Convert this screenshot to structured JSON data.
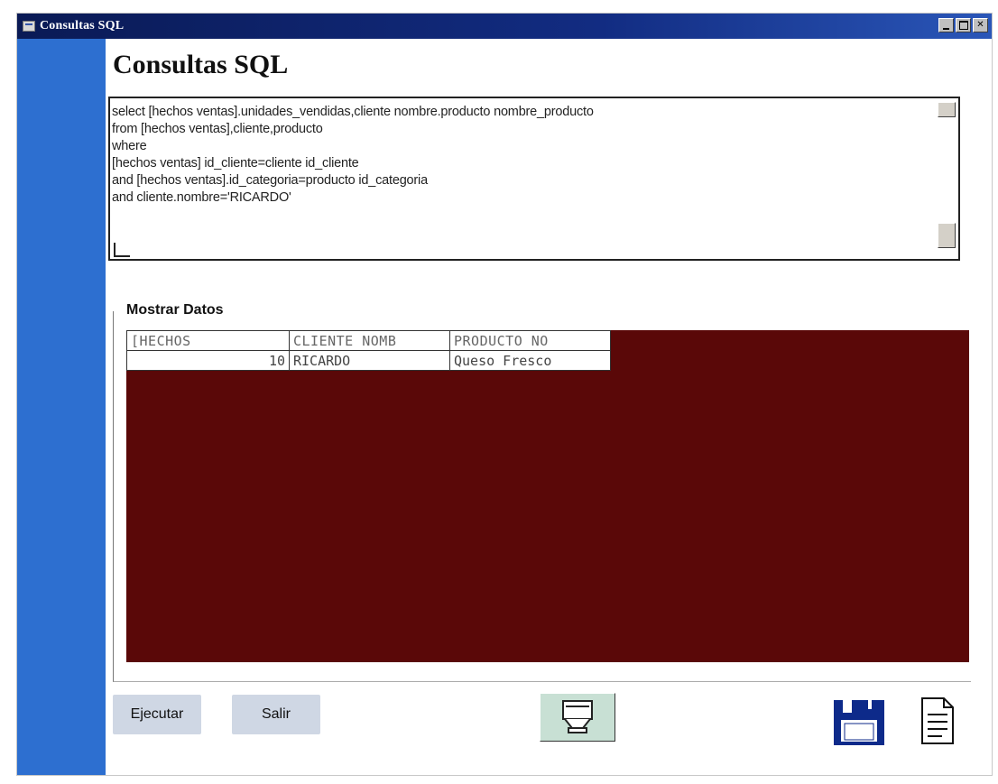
{
  "window": {
    "title": "Consultas SQL",
    "controls": [
      "minimize",
      "maximize",
      "close"
    ]
  },
  "heading": "Consultas SQL",
  "sql_editor": {
    "lines": [
      "select [hechos ventas].unidades_vendidas,cliente nombre.producto nombre_producto",
      "from [hechos ventas],cliente,producto",
      "where",
      "[hechos ventas] id_cliente=cliente id_cliente",
      "and [hechos ventas].id_categoria=producto id_categoria",
      "and cliente.nombre='RICARDO'"
    ]
  },
  "results": {
    "group_label": "Mostrar Datos",
    "columns": [
      "[HECHOS",
      "CLIENTE NOMB",
      "PRODUCTO NO"
    ],
    "rows": [
      [
        "10",
        "RICARDO",
        "Queso Fresco"
      ]
    ]
  },
  "buttons": {
    "execute": "Ejecutar",
    "exit": "Salir"
  },
  "icons": {
    "query_button": "database-query-icon",
    "save": "floppy-disk-icon",
    "report": "document-icon"
  },
  "colors": {
    "title_bar": "#122c82",
    "side_panel": "#2d6fd0",
    "grid_background": "#5a0808",
    "button_background": "#cfd7e4"
  }
}
